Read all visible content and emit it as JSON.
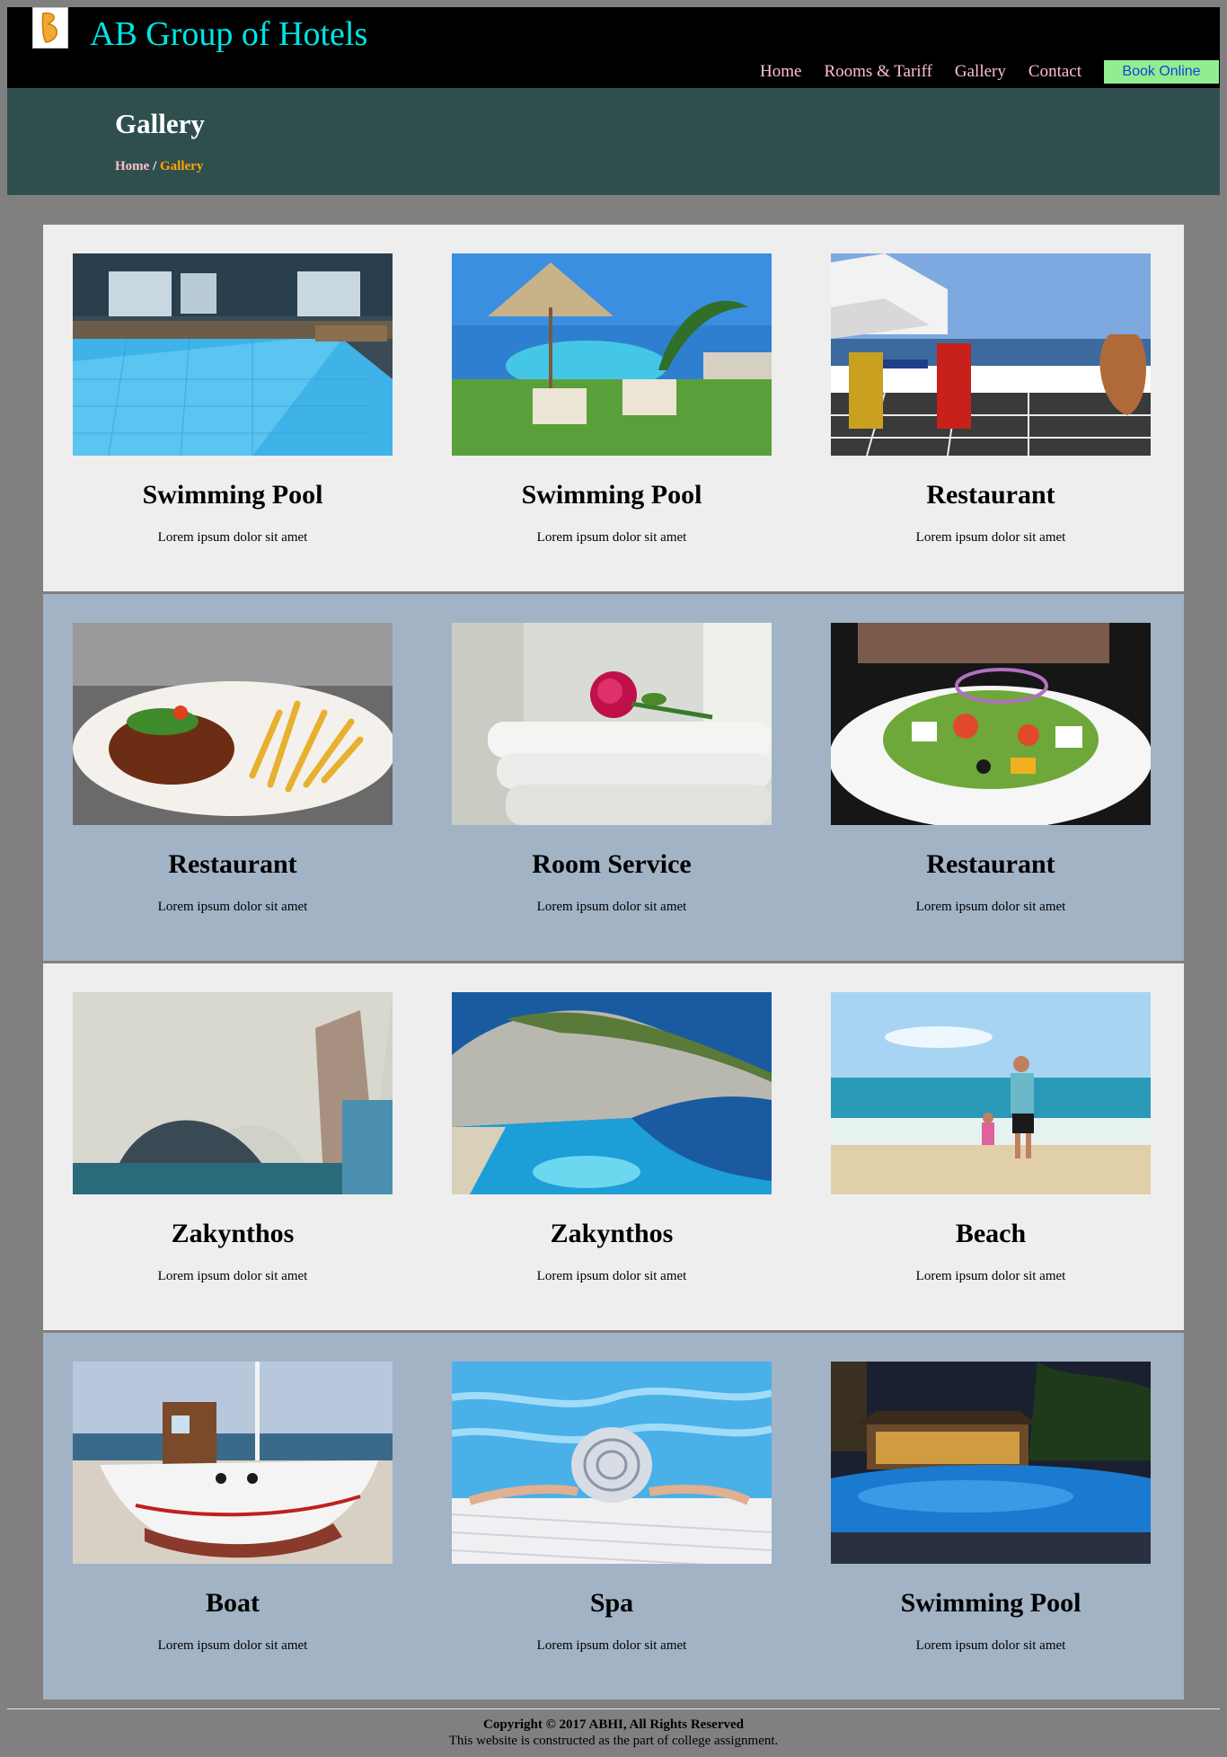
{
  "header": {
    "logo_icon": "hotel-logo-icon",
    "title": "AB Group of Hotels",
    "nav": [
      "Home",
      "Rooms & Tariff",
      "Gallery",
      "Contact"
    ],
    "book_button": "Book Online"
  },
  "banner": {
    "title": "Gallery",
    "breadcrumb": {
      "home": "Home",
      "separator": " / ",
      "current": "Gallery"
    }
  },
  "gallery": [
    {
      "title": "Swimming Pool",
      "caption": "Lorem ipsum dolor sit amet",
      "image": "indoor-pool-photo"
    },
    {
      "title": "Swimming Pool",
      "caption": "Lorem ipsum dolor sit amet",
      "image": "pool-umbrella-photo"
    },
    {
      "title": "Restaurant",
      "caption": "Lorem ipsum dolor sit amet",
      "image": "terrace-restaurant-photo"
    },
    {
      "title": "Restaurant",
      "caption": "Lorem ipsum dolor sit amet",
      "image": "steak-fries-photo"
    },
    {
      "title": "Room Service",
      "caption": "Lorem ipsum dolor sit amet",
      "image": "towels-rose-photo"
    },
    {
      "title": "Restaurant",
      "caption": "Lorem ipsum dolor sit amet",
      "image": "salad-plate-photo"
    },
    {
      "title": "Zakynthos",
      "caption": "Lorem ipsum dolor sit amet",
      "image": "rock-arch-photo"
    },
    {
      "title": "Zakynthos",
      "caption": "Lorem ipsum dolor sit amet",
      "image": "navagio-bay-photo"
    },
    {
      "title": "Beach",
      "caption": "Lorem ipsum dolor sit amet",
      "image": "beach-walk-photo"
    },
    {
      "title": "Boat",
      "caption": "Lorem ipsum dolor sit amet",
      "image": "boat-photo"
    },
    {
      "title": "Spa",
      "caption": "Lorem ipsum dolor sit amet",
      "image": "spa-pool-hat-photo"
    },
    {
      "title": "Swimming Pool",
      "caption": "Lorem ipsum dolor sit amet",
      "image": "night-pool-photo"
    }
  ],
  "footer": {
    "copyright": "Copyright © 2017 ABHI, All Rights Reserved",
    "note": "This website is constructed as the part of college assignment."
  },
  "colors": {
    "page_bg": "#808080",
    "header_bg": "#000000",
    "title": "#00e5e5",
    "nav": "#ffc0cb",
    "book_bg": "#90ee90",
    "banner_bg": "#2f4f4f",
    "breadcrumb_current": "#ffa500",
    "row_light": "#eeeeee",
    "row_blue": "#a2b3c6"
  }
}
